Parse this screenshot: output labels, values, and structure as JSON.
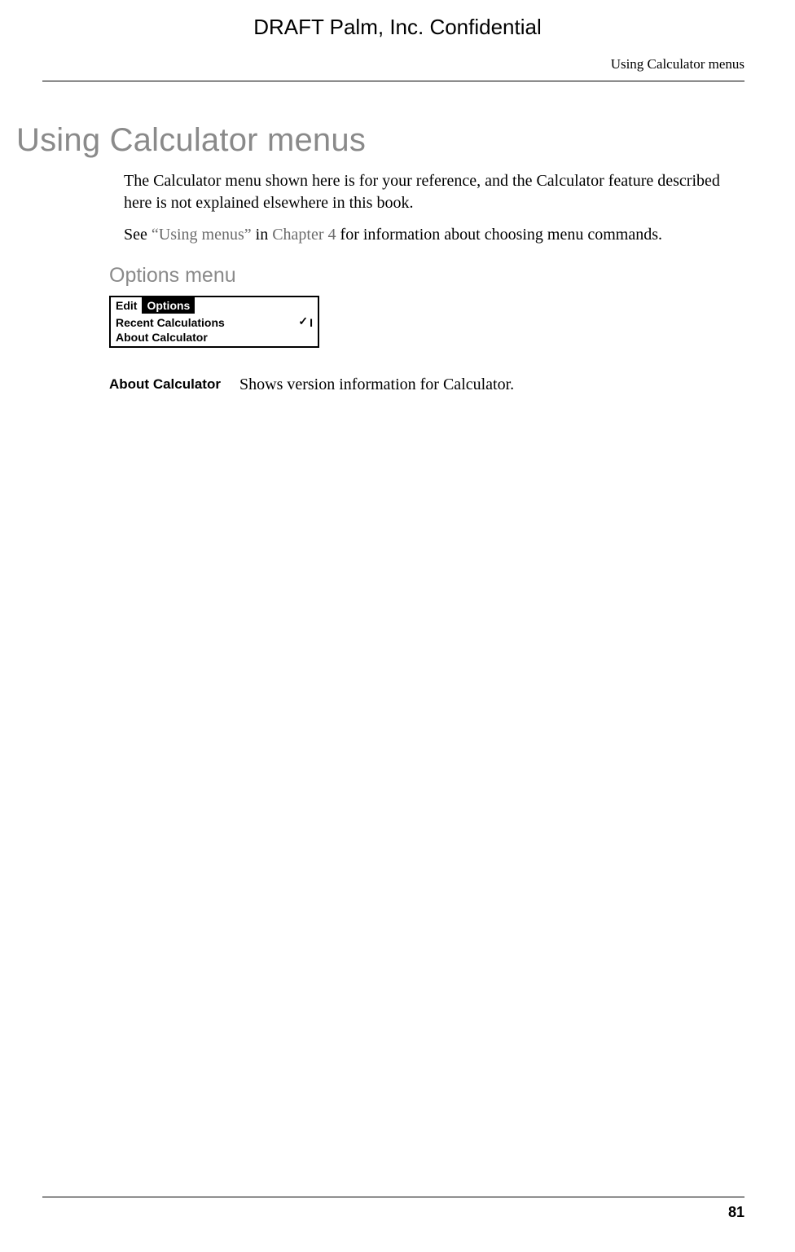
{
  "header": {
    "draft_line": "DRAFT   Palm, Inc. Confidential",
    "running_head": "Using Calculator menus"
  },
  "section": {
    "title": "Using Calculator menus",
    "para1": "The Calculator menu shown here is for your reference, and the Calculator feature described here is not explained elsewhere in this book.",
    "para2_prefix": "See ",
    "para2_link1": "“Using menus”",
    "para2_mid": " in ",
    "para2_link2": "Chapter 4",
    "para2_suffix": " for information about choosing menu commands.",
    "sub_heading": "Options menu"
  },
  "palm_menu": {
    "tab_edit": "Edit",
    "tab_options": "Options",
    "item_recent": "Recent Calculations",
    "item_recent_shortcut": "I",
    "item_about": "About Calculator"
  },
  "definition": {
    "label": "About Calculator",
    "text": "Shows version information for Calculator."
  },
  "footer": {
    "page": "81"
  }
}
